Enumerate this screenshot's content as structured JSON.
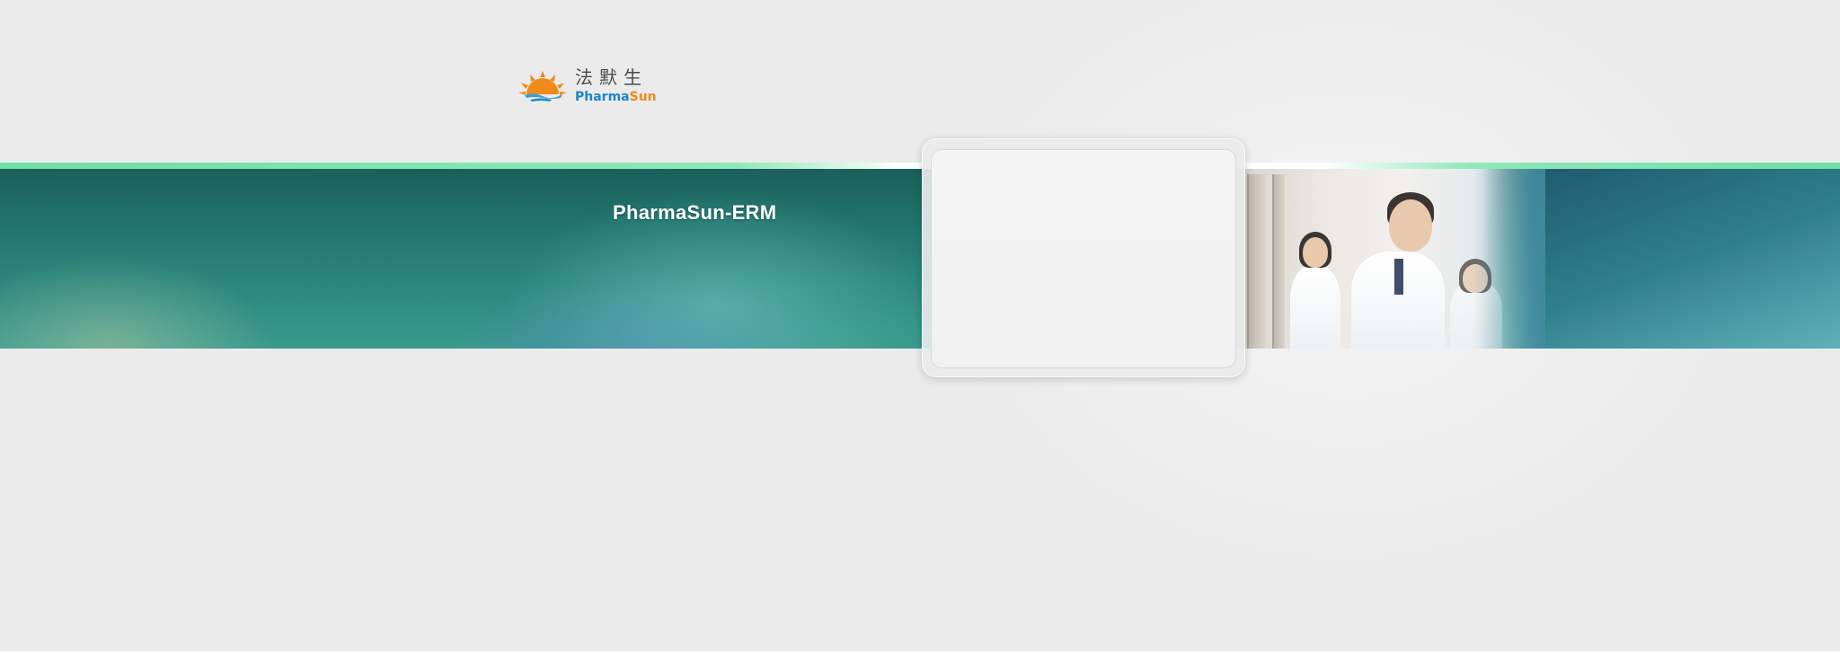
{
  "logo": {
    "chinese_name": "法默生",
    "english_part1": "Pharma",
    "english_part2": "Sun"
  },
  "banner": {
    "title": "PharmaSun-ERM"
  },
  "colors": {
    "brand_blue": "#1c86c8",
    "brand_orange": "#f08a1a",
    "banner_teal": "#227a72",
    "accent_green": "#6fe0a6"
  },
  "icons": {
    "logo": "sun-logo-icon",
    "photo": "doctors-photo"
  }
}
